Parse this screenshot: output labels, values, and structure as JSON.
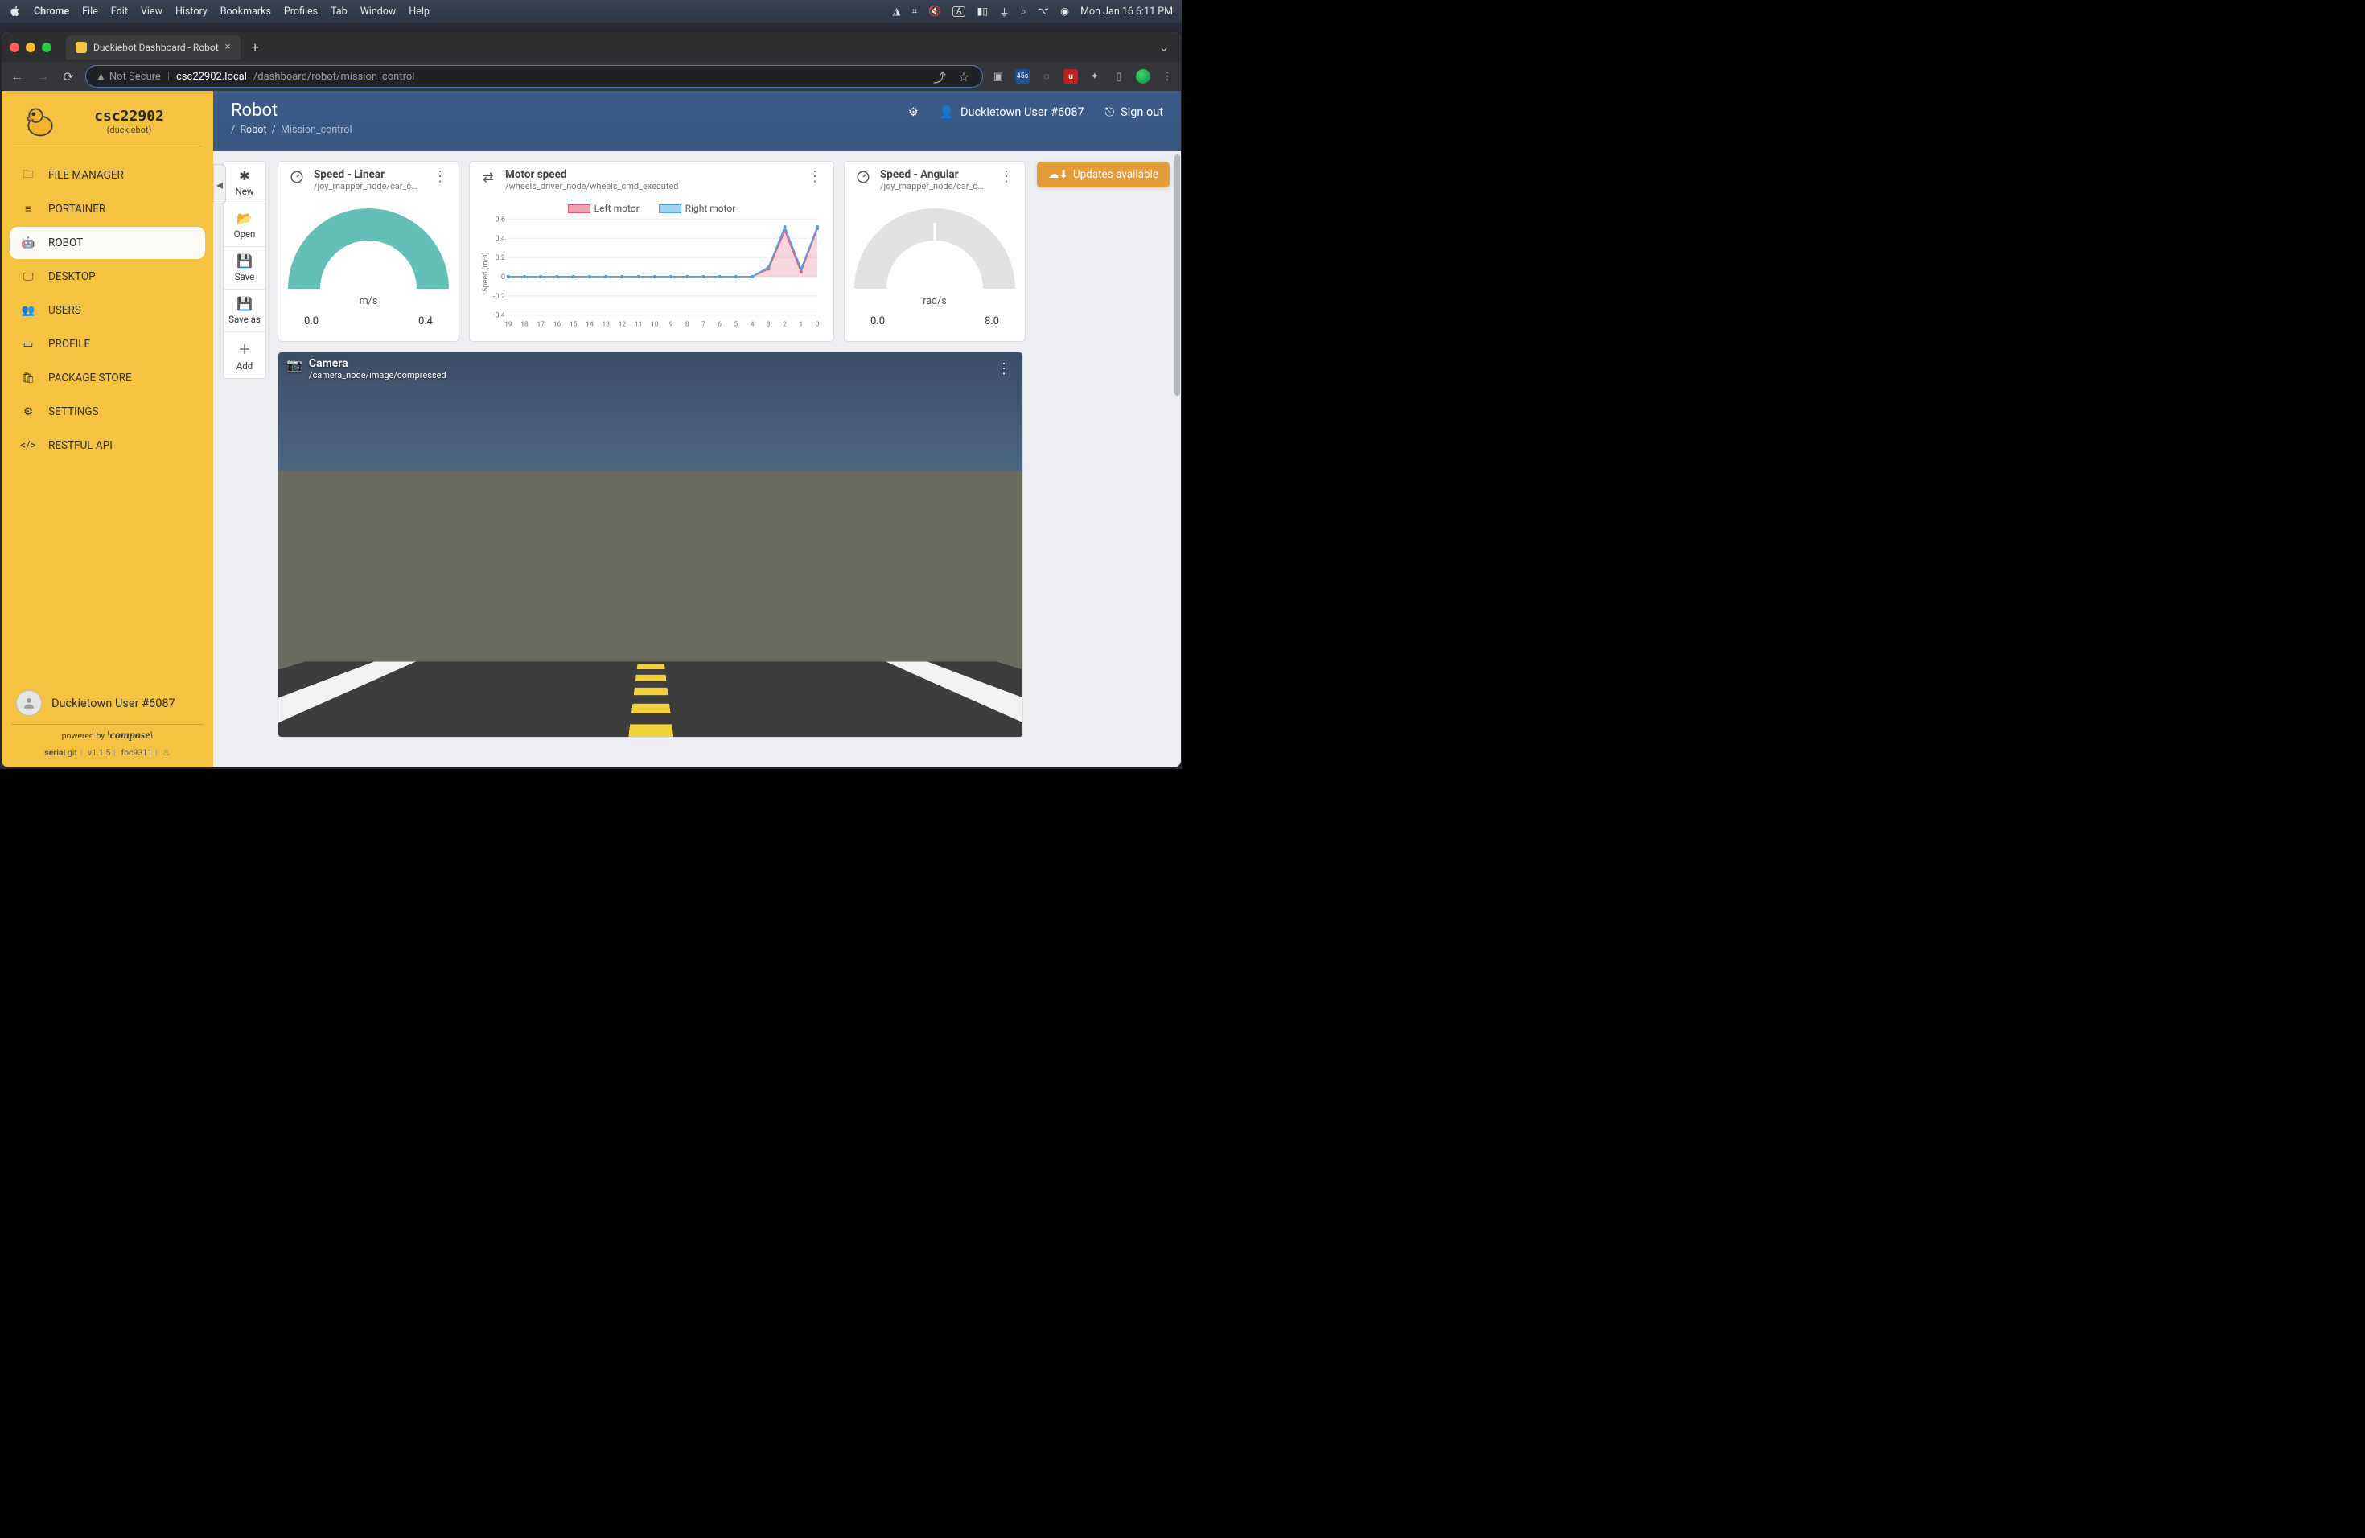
{
  "menubar": {
    "app": "Chrome",
    "items": [
      "File",
      "Edit",
      "View",
      "History",
      "Bookmarks",
      "Profiles",
      "Tab",
      "Window",
      "Help"
    ],
    "clock": "Mon Jan 16  6:11 PM"
  },
  "browser": {
    "tab_title": "Duckiebot Dashboard - Robot",
    "url_insecure": "Not Secure",
    "url_host": "csc22902.local",
    "url_path": "/dashboard/robot/mission_control",
    "badge": "45s"
  },
  "sidebar": {
    "brand_name": "csc22902",
    "brand_sub": "(duckiebot)",
    "items": [
      {
        "icon": "folder",
        "label": "FILE MANAGER"
      },
      {
        "icon": "sliders",
        "label": "PORTAINER"
      },
      {
        "icon": "android",
        "label": "ROBOT"
      },
      {
        "icon": "desktop",
        "label": "DESKTOP"
      },
      {
        "icon": "users",
        "label": "USERS"
      },
      {
        "icon": "id",
        "label": "PROFILE"
      },
      {
        "icon": "bag",
        "label": "PACKAGE STORE"
      },
      {
        "icon": "gear",
        "label": "SETTINGS"
      },
      {
        "icon": "code",
        "label": "RESTFUL API"
      }
    ],
    "user": "Duckietown User #6087",
    "footer_powered": "powered by",
    "footer_brand": "\\compose\\",
    "footer_serial": "serial",
    "footer_git": "git",
    "footer_ver": "v1.1.5",
    "footer_hash": "fbc9311"
  },
  "header": {
    "title": "Robot",
    "crumb_root": "Robot",
    "crumb_leaf": "Mission_control",
    "user": "Duckietown User #6087",
    "signout": "Sign out",
    "updates": "Updates available"
  },
  "toolbar": {
    "new": "New",
    "open": "Open",
    "save": "Save",
    "saveas": "Save as",
    "add": "Add"
  },
  "cards": {
    "speed_linear": {
      "title": "Speed - Linear",
      "topic": "/joy_mapper_node/car_c…",
      "unit": "m/s",
      "min": "0.0",
      "max": "0.4"
    },
    "motor": {
      "title": "Motor speed",
      "topic": "/wheels_driver_node/wheels_cmd_executed",
      "legend_left": "Left motor",
      "legend_right": "Right motor"
    },
    "speed_angular": {
      "title": "Speed - Angular",
      "topic": "/joy_mapper_node/car_c…",
      "unit": "rad/s",
      "min": "0.0",
      "max": "8.0"
    },
    "camera": {
      "title": "Camera",
      "topic": "/camera_node/image/compressed"
    }
  },
  "chart_data": {
    "type": "line",
    "title": "Motor speed",
    "xlabel": "",
    "ylabel": "Speed (m/s)",
    "ylim": [
      -0.4,
      0.6
    ],
    "yticks": [
      -0.4,
      -0.2,
      0,
      0.2,
      0.4,
      0.6
    ],
    "x": [
      19,
      18,
      17,
      16,
      15,
      14,
      13,
      12,
      11,
      10,
      9,
      8,
      7,
      6,
      5,
      4,
      3,
      2,
      1,
      0
    ],
    "series": [
      {
        "name": "Left motor",
        "color": "#e55b7b",
        "values": [
          0,
          0,
          0,
          0,
          0,
          0,
          0,
          0,
          0,
          0,
          0,
          0,
          0,
          0,
          0,
          0,
          0.08,
          0.48,
          0.05,
          0.5
        ]
      },
      {
        "name": "Right motor",
        "color": "#4ba5e1",
        "values": [
          0,
          0,
          0,
          0,
          0,
          0,
          0,
          0,
          0,
          0,
          0,
          0,
          0,
          0,
          0,
          0,
          0.1,
          0.52,
          0.08,
          0.52
        ]
      }
    ]
  }
}
